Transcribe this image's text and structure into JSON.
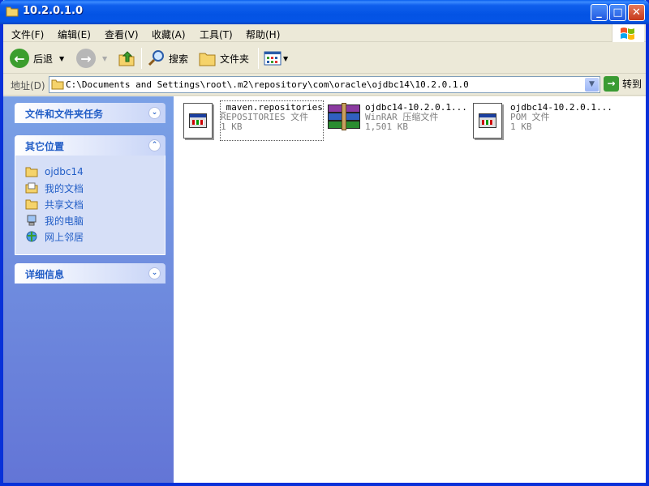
{
  "window": {
    "title": "10.2.0.1.0",
    "minimize": "_",
    "maximize": "□",
    "close": "✕"
  },
  "menu": [
    {
      "label": "文件(F)"
    },
    {
      "label": "编辑(E)"
    },
    {
      "label": "查看(V)"
    },
    {
      "label": "收藏(A)"
    },
    {
      "label": "工具(T)"
    },
    {
      "label": "帮助(H)"
    }
  ],
  "toolbar": {
    "back": "后退",
    "search": "搜索",
    "folders": "文件夹"
  },
  "address": {
    "label": "地址(D)",
    "path": "C:\\Documents and Settings\\root\\.m2\\repository\\com\\oracle\\ojdbc14\\10.2.0.1.0",
    "go": "转到"
  },
  "tasks": {
    "panel1": {
      "title": "文件和文件夹任务"
    },
    "panel2": {
      "title": "其它位置",
      "items": [
        {
          "label": "ojdbc14",
          "icon": "folder-icon"
        },
        {
          "label": "我的文档",
          "icon": "my-documents-icon"
        },
        {
          "label": "共享文档",
          "icon": "folder-icon"
        },
        {
          "label": "我的电脑",
          "icon": "computer-icon"
        },
        {
          "label": "网上邻居",
          "icon": "network-icon"
        }
      ]
    },
    "panel3": {
      "title": "详细信息"
    }
  },
  "files": [
    {
      "name": "_maven.repositories",
      "type": "REPOSITORIES 文件",
      "size": "1 KB",
      "icon": "generic-file-icon",
      "selected": true
    },
    {
      "name": "ojdbc14-10.2.0.1...",
      "type": "WinRAR 压缩文件",
      "size": "1,501 KB",
      "icon": "winrar-archive-icon",
      "selected": false
    },
    {
      "name": "ojdbc14-10.2.0.1...",
      "type": "POM 文件",
      "size": "1 KB",
      "icon": "generic-file-icon",
      "selected": false
    }
  ],
  "colors": {
    "titlebar": "#0554e6",
    "taskpane": "#6e8fe0",
    "link": "#215dc6"
  }
}
